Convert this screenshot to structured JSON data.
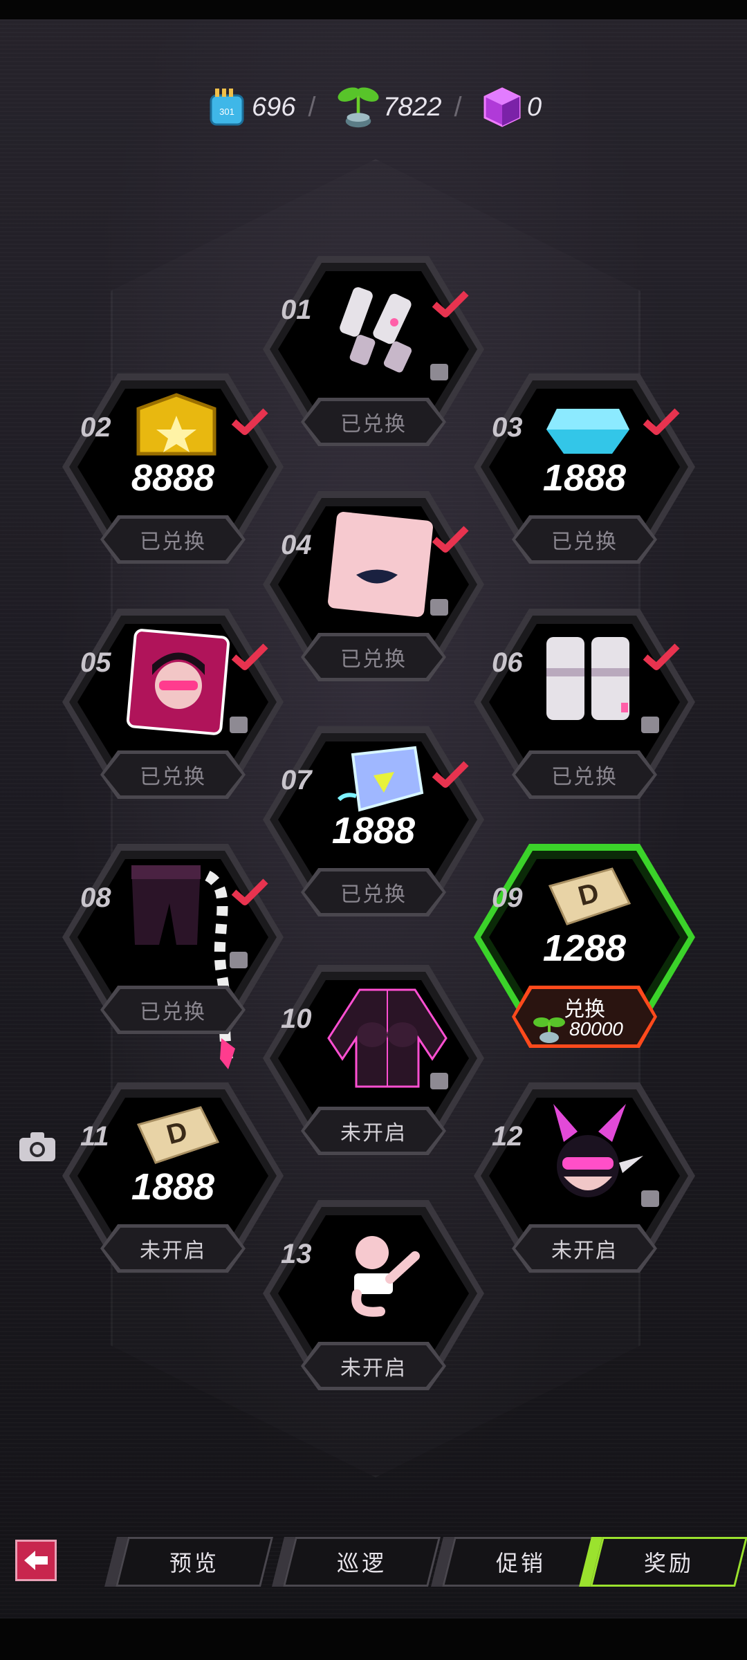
{
  "currency": {
    "chips": {
      "icon": "chip-token-icon",
      "value": "696"
    },
    "sprout": {
      "icon": "sprout-pot-icon",
      "value": "7822"
    },
    "cube": {
      "icon": "purple-cube-icon",
      "value": "0"
    },
    "separator": "/"
  },
  "rewards": [
    {
      "num": "01",
      "status": "已兑换",
      "icon": "gauntlets-icon",
      "claimed": true
    },
    {
      "num": "02",
      "status": "已兑换",
      "amount": "8888",
      "icon": "gold-coin-icon",
      "claimed": true
    },
    {
      "num": "03",
      "status": "已兑换",
      "amount": "1888",
      "icon": "blue-gem-icon",
      "claimed": true
    },
    {
      "num": "04",
      "status": "已兑换",
      "icon": "lips-makeup-icon",
      "claimed": true
    },
    {
      "num": "05",
      "status": "已兑换",
      "icon": "avatar-portrait-icon",
      "claimed": true
    },
    {
      "num": "06",
      "status": "已兑换",
      "icon": "boots-icon",
      "claimed": true
    },
    {
      "num": "07",
      "status": "已兑换",
      "amount": "1888",
      "icon": "crystal-ticket-icon",
      "claimed": true
    },
    {
      "num": "08",
      "status": "已兑换",
      "icon": "pants-tail-icon",
      "claimed": true
    },
    {
      "num": "09",
      "exchange_label": "兑换",
      "exchange_cost": "80000",
      "amount": "1288",
      "icon": "d-card-icon",
      "active": true
    },
    {
      "num": "10",
      "status": "未开启",
      "icon": "jacket-icon"
    },
    {
      "num": "11",
      "status": "未开启",
      "amount": "1888",
      "icon": "d-card-icon"
    },
    {
      "num": "12",
      "status": "未开启",
      "icon": "horned-headgear-icon"
    },
    {
      "num": "13",
      "status": "未开启",
      "icon": "pose-emote-icon"
    }
  ],
  "nav": {
    "back": "back-arrow-icon",
    "tabs": [
      "预览",
      "巡逻",
      "促销",
      "奖励"
    ],
    "active_tab": "奖励"
  },
  "colors": {
    "accent_green": "#3bd32a",
    "check_red": "#e8334f",
    "exchange_orange": "#ff4a1c",
    "back_pink": "#c8264e"
  }
}
